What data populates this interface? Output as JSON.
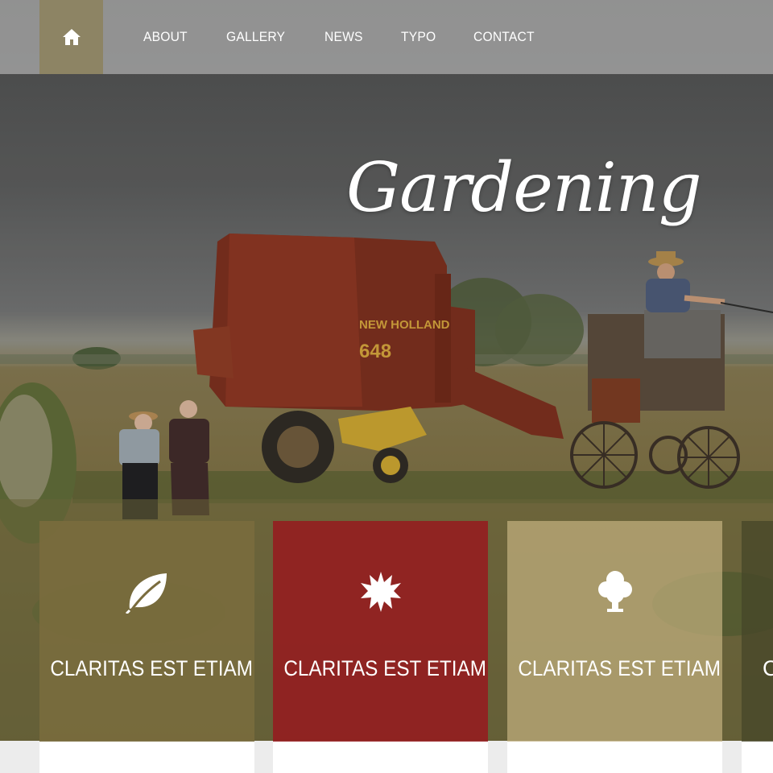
{
  "nav": {
    "home_icon": "home-icon",
    "items": [
      {
        "label": "ABOUT"
      },
      {
        "label": "GALLERY"
      },
      {
        "label": "NEWS"
      },
      {
        "label": "TYPO"
      },
      {
        "label": "CONTACT"
      }
    ]
  },
  "hero": {
    "title": "Gardening",
    "machine_brand": "NEW HOLLAND",
    "machine_model": "648"
  },
  "features": [
    {
      "label": "CLARITAS EST ETIAM",
      "icon": "leaf-icon",
      "color": "#7a6c3e"
    },
    {
      "label": "CLARITAS EST ETIAM",
      "icon": "sun-burst-icon",
      "color": "#961a1e"
    },
    {
      "label": "CLARITAS EST ETIAM",
      "icon": "tree-icon",
      "color": "#c4b280"
    },
    {
      "label": "C",
      "icon": "",
      "color": "#464628"
    }
  ],
  "colors": {
    "nav_bg": "#afafaf",
    "home_bg": "#8d8464",
    "accent_red": "#961a1e",
    "page_bg": "#ececec"
  }
}
